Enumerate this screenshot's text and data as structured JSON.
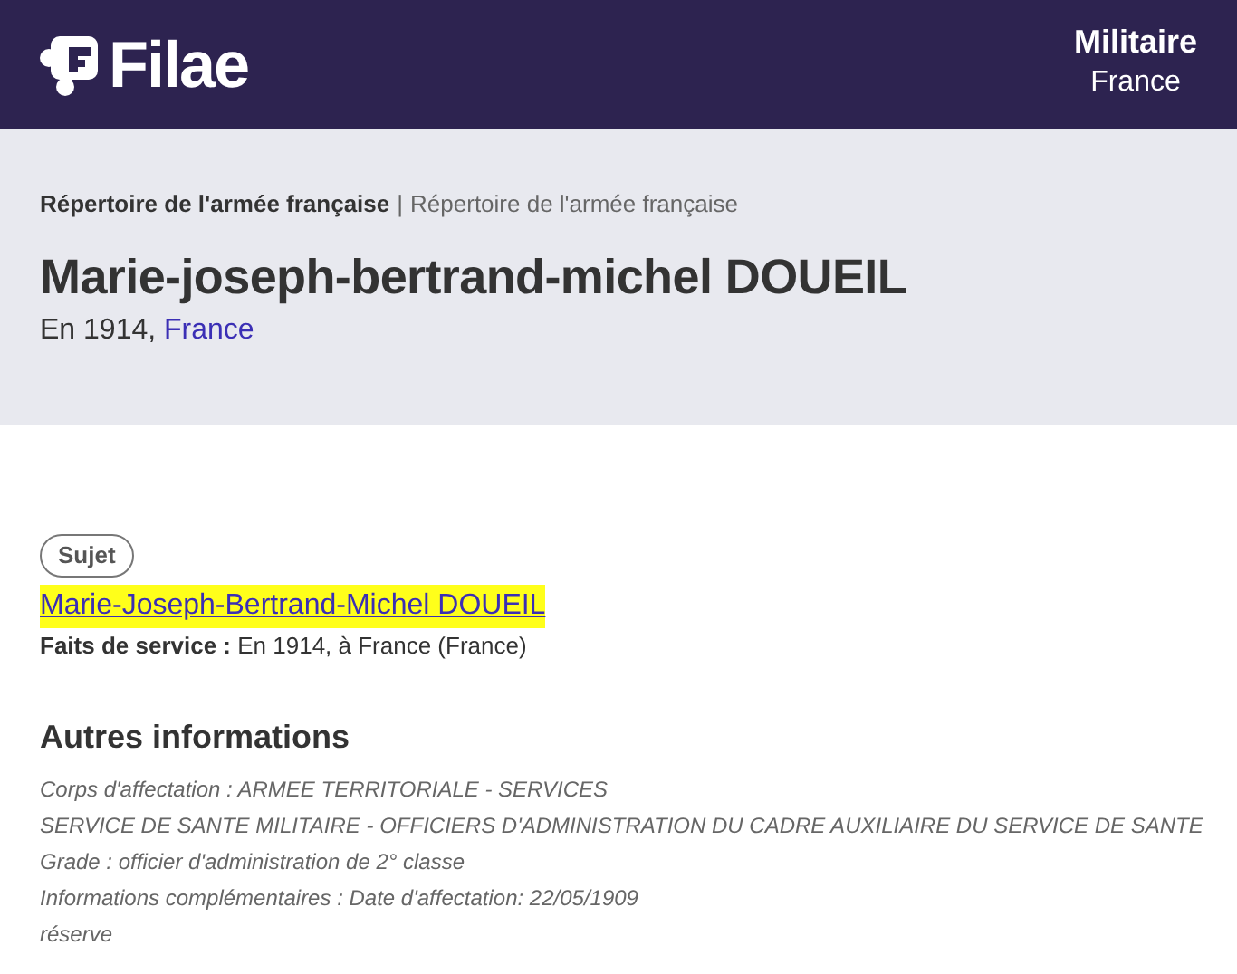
{
  "header": {
    "logo_text": "Filae",
    "category": "Militaire",
    "country": "France"
  },
  "breadcrumb": {
    "primary": "Répertoire de l'armée française",
    "separator": "|",
    "secondary": "Répertoire de l'armée française"
  },
  "title": "Marie-joseph-bertrand-michel DOUEIL",
  "subtitle": {
    "prefix": "En 1914, ",
    "place": "France"
  },
  "role_badge": "Sujet",
  "subject_name": "Marie-Joseph-Bertrand-Michel DOUEIL",
  "service": {
    "label": "Faits de service :",
    "value": " En 1914, à France (France)"
  },
  "other_info": {
    "heading": "Autres informations",
    "lines": [
      "Corps d'affectation : ARMEE TERRITORIALE - SERVICES",
      "SERVICE DE SANTE MILITAIRE - OFFICIERS D'ADMINISTRATION DU CADRE AUXILIAIRE DU SERVICE DE SANTE",
      "Grade : officier d'administration de 2° classe",
      "Informations complémentaires : Date d'affectation: 22/05/1909",
      "réserve"
    ]
  }
}
